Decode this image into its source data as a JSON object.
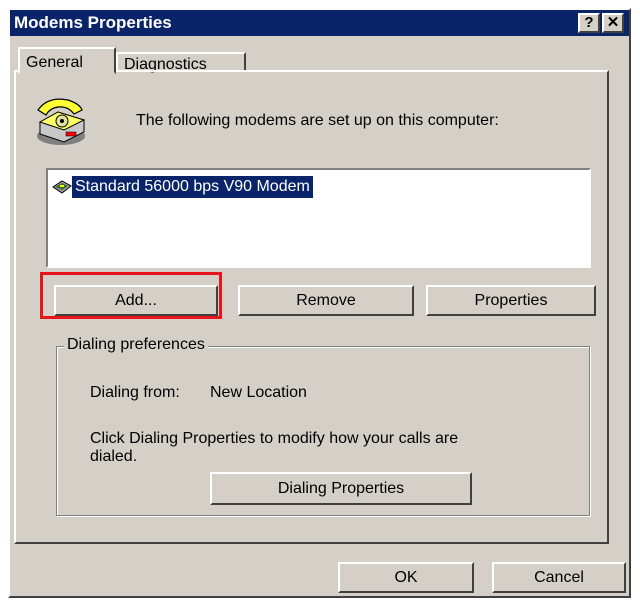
{
  "window": {
    "title": "Modems Properties",
    "help_label": "?",
    "close_label": "✕"
  },
  "tabs": [
    {
      "label": "General"
    },
    {
      "label": "Diagnostics"
    }
  ],
  "intro_text": "The following modems are set up on this computer:",
  "modems": [
    {
      "name": "Standard 56000 bps V90 Modem"
    }
  ],
  "buttons": {
    "add": "Add...",
    "remove": "Remove",
    "properties": "Properties"
  },
  "dialing": {
    "group_label": "Dialing preferences",
    "from_label": "Dialing from:",
    "from_value": "New Location",
    "hint_line1": "Click Dialing Properties to modify how your calls are",
    "hint_line2": "dialed.",
    "button_label": "Dialing Properties"
  },
  "footer": {
    "ok": "OK",
    "cancel": "Cancel"
  },
  "colors": {
    "titlebar": "#0a246a",
    "face": "#d4d0c8",
    "selection": "#0a246a",
    "highlight_box": "#e8141c"
  }
}
